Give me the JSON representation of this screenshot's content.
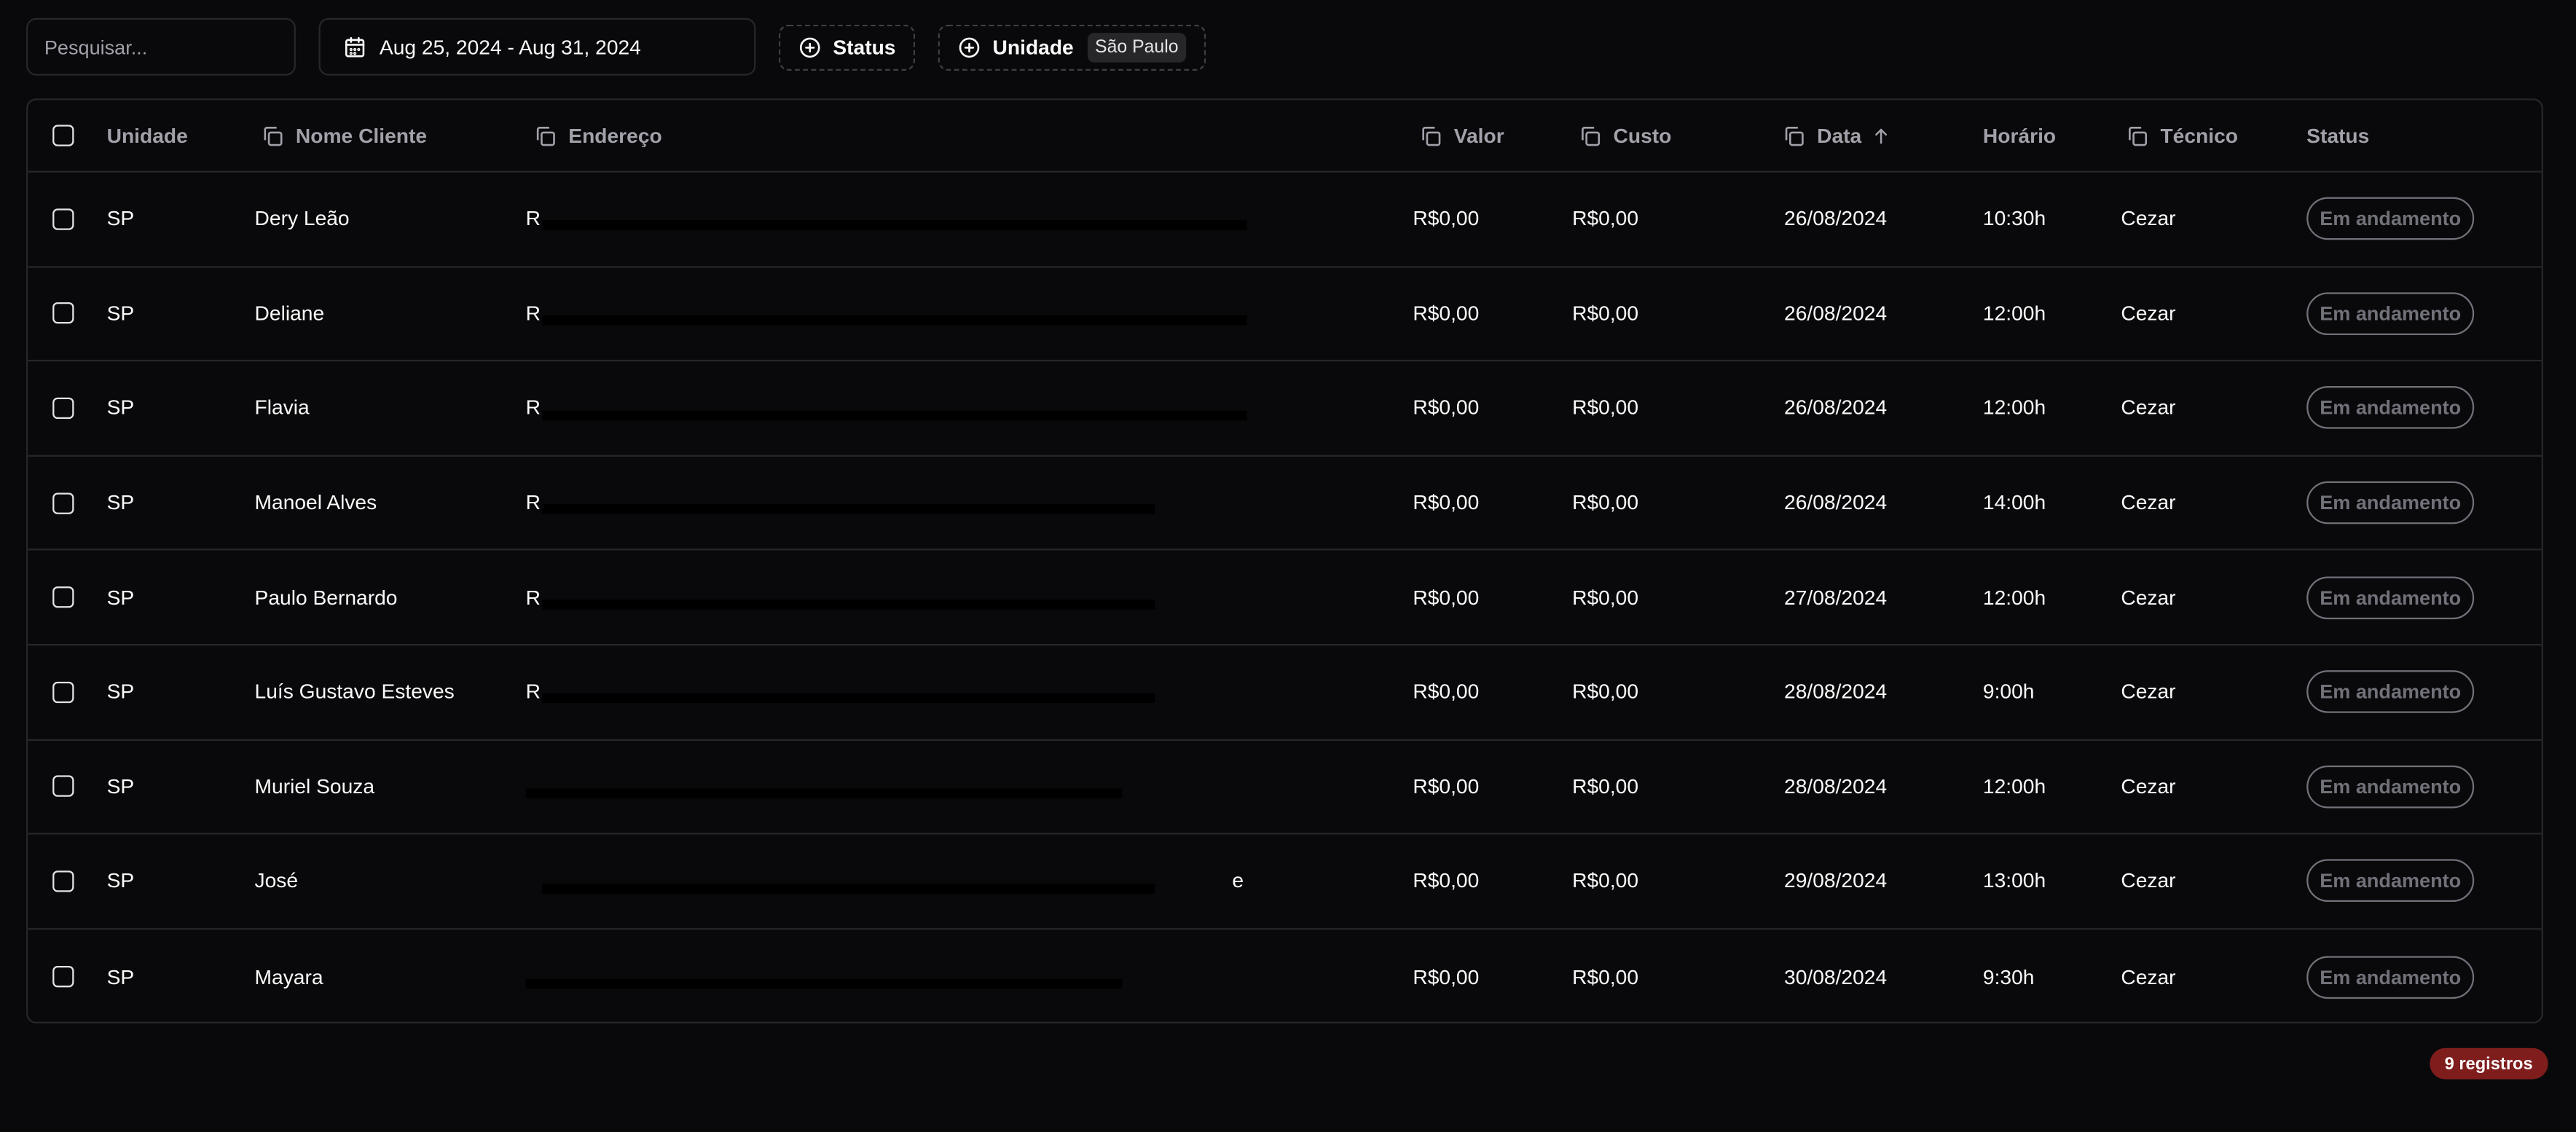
{
  "search": {
    "placeholder": "Pesquisar..."
  },
  "date_range": {
    "label": "Aug 25, 2024 - Aug 31, 2024",
    "icon": "calendar-icon"
  },
  "filters": {
    "status_label": "Status",
    "unit_label": "Unidade",
    "unit_value": "São Paulo",
    "icon": "plus-circle-icon"
  },
  "table": {
    "headers": {
      "unit": "Unidade",
      "name": "Nome Cliente",
      "address": "Endereço",
      "valor": "Valor",
      "custo": "Custo",
      "data": "Data",
      "hora": "Horário",
      "tecnico": "Técnico",
      "status": "Status"
    },
    "rows": [
      {
        "unit": "SP",
        "name": "Dery Leão",
        "address": "R",
        "valor": "R$0,00",
        "custo": "R$0,00",
        "data": "26/08/2024",
        "hora": "10:30h",
        "tecnico": "Cezar",
        "status": "Em andamento"
      },
      {
        "unit": "SP",
        "name": "Deliane",
        "address": "R",
        "valor": "R$0,00",
        "custo": "R$0,00",
        "data": "26/08/2024",
        "hora": "12:00h",
        "tecnico": "Cezar",
        "status": "Em andamento"
      },
      {
        "unit": "SP",
        "name": "Flavia",
        "address": "R",
        "valor": "R$0,00",
        "custo": "R$0,00",
        "data": "26/08/2024",
        "hora": "12:00h",
        "tecnico": "Cezar",
        "status": "Em andamento"
      },
      {
        "unit": "SP",
        "name": "Manoel Alves",
        "address": "R",
        "valor": "R$0,00",
        "custo": "R$0,00",
        "data": "26/08/2024",
        "hora": "14:00h",
        "tecnico": "Cezar",
        "status": "Em andamento"
      },
      {
        "unit": "SP",
        "name": "Paulo Bernardo",
        "address": "R",
        "valor": "R$0,00",
        "custo": "R$0,00",
        "data": "27/08/2024",
        "hora": "12:00h",
        "tecnico": "Cezar",
        "status": "Em andamento"
      },
      {
        "unit": "SP",
        "name": "Luís Gustavo Esteves",
        "address": "R",
        "valor": "R$0,00",
        "custo": "R$0,00",
        "data": "28/08/2024",
        "hora": "9:00h",
        "tecnico": "Cezar",
        "status": "Em andamento"
      },
      {
        "unit": "SP",
        "name": "Muriel Souza",
        "address": "",
        "valor": "R$0,00",
        "custo": "R$0,00",
        "data": "28/08/2024",
        "hora": "12:00h",
        "tecnico": "Cezar",
        "status": "Em andamento"
      },
      {
        "unit": "SP",
        "name": "José",
        "address": "e",
        "valor": "R$0,00",
        "custo": "R$0,00",
        "data": "29/08/2024",
        "hora": "13:00h",
        "tecnico": "Cezar",
        "status": "Em andamento"
      },
      {
        "unit": "SP",
        "name": "Mayara",
        "address": "",
        "valor": "R$0,00",
        "custo": "R$0,00",
        "data": "30/08/2024",
        "hora": "9:30h",
        "tecnico": "Cezar",
        "status": "Em andamento"
      }
    ]
  },
  "footer": {
    "count_label": "9 registros"
  }
}
